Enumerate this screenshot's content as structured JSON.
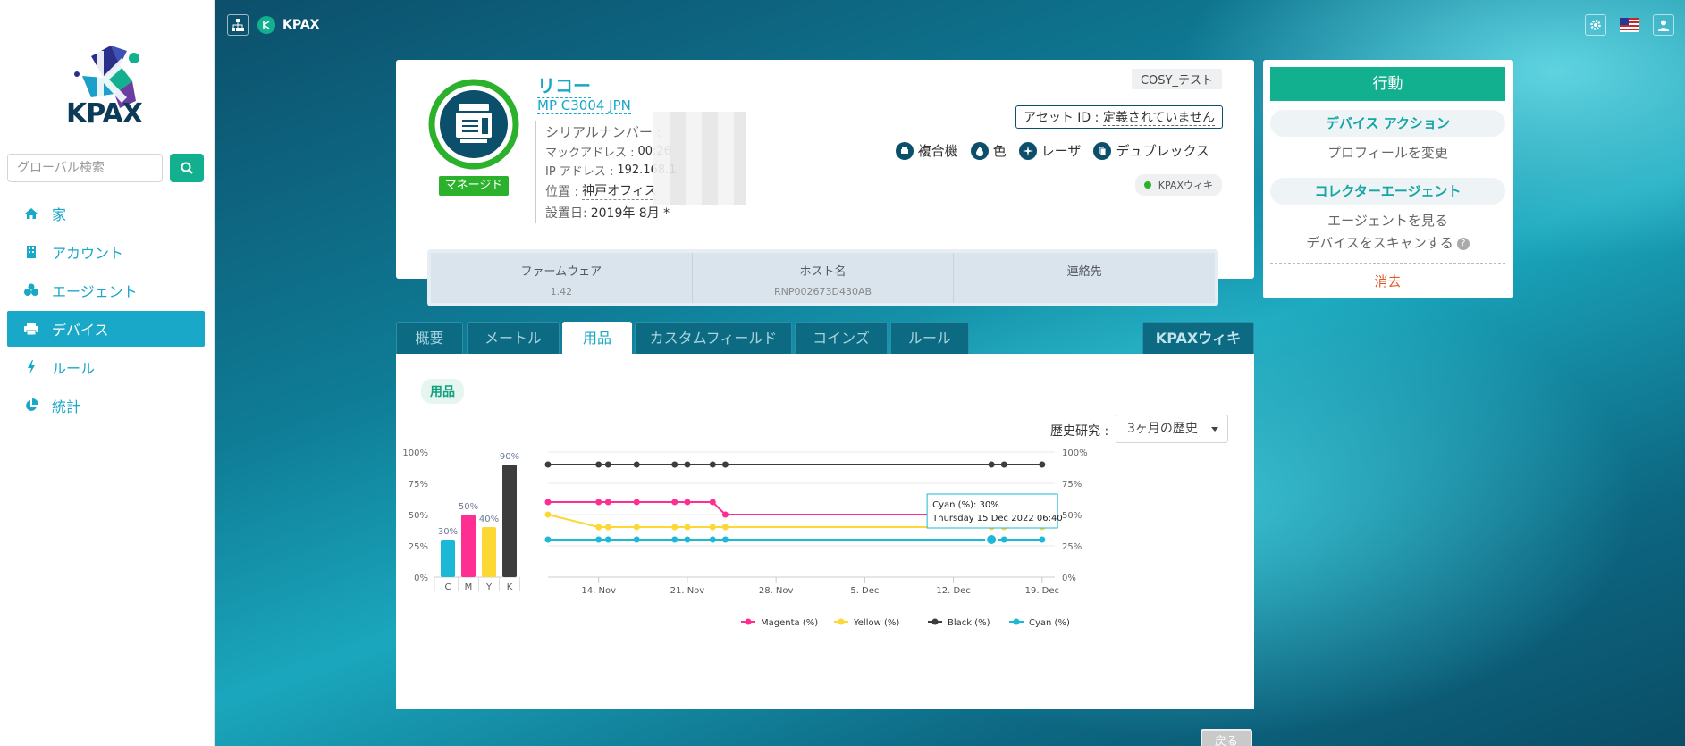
{
  "app": {
    "name": "KPAX",
    "logo_text": "KPAX"
  },
  "sidebar": {
    "search_placeholder": "グローバル検索",
    "items": [
      {
        "label": "家",
        "icon": "home-icon"
      },
      {
        "label": "アカウント",
        "icon": "building-icon"
      },
      {
        "label": "エージェント",
        "icon": "agents-icon"
      },
      {
        "label": "デバイス",
        "icon": "printer-icon",
        "active": true
      },
      {
        "label": "ルール",
        "icon": "bolt-icon"
      },
      {
        "label": "統計",
        "icon": "pie-chart-icon"
      }
    ]
  },
  "device": {
    "brand": "リコー",
    "model": "MP C3004 JPN",
    "managed_label": "マネージド",
    "serial_label": "シリアルナンバー :",
    "mac_label": "マックアドレス :",
    "mac_value": "00:26",
    "ip_label": "IP アドレス :",
    "ip_value": "192.168.1",
    "location_label": "位置 :",
    "location_value": "神戸オフィス",
    "install_label": "設置日:",
    "install_value": "2019年 8月 *",
    "tag": "COSY_テスト",
    "asset_label": "アセット ID : ",
    "asset_value": "定義されていません",
    "capabilities": [
      {
        "label": "複合機",
        "icon": "mfp-icon"
      },
      {
        "label": "色",
        "icon": "drop-icon"
      },
      {
        "label": "レーザ",
        "icon": "laser-icon"
      },
      {
        "label": "デュプレックス",
        "icon": "duplex-icon"
      }
    ],
    "wiki_label": "KPAXウィキ",
    "specs": [
      {
        "label": "ファームウェア",
        "value": "1.42"
      },
      {
        "label": "ホスト名",
        "value": "RNP002673D430AB"
      },
      {
        "label": "連絡先",
        "value": ""
      }
    ]
  },
  "actions": {
    "title": "行動",
    "device_actions_label": "デバイス アクション",
    "change_profile": "プロフィールを変更",
    "collector_agent_label": "コレクターエージェント",
    "view_agent": "エージェントを見る",
    "scan_device": "デバイスをスキャンする",
    "delete": "消去"
  },
  "tabs": [
    {
      "label": "概要"
    },
    {
      "label": "メートル"
    },
    {
      "label": "用品",
      "active": true
    },
    {
      "label": "カスタムフィールド"
    },
    {
      "label": "コインズ"
    },
    {
      "label": "ルール"
    }
  ],
  "wiki_tab": "KPAXウィキ",
  "supplies": {
    "section_label": "用品",
    "history_label": "歴史研究 :",
    "history_selected": "3ヶ月の歴史",
    "back_label": "戻る"
  },
  "chart_data": [
    {
      "type": "bar",
      "categories": [
        "C",
        "M",
        "Y",
        "K"
      ],
      "values": [
        30,
        50,
        40,
        90
      ],
      "data_labels": [
        "30%",
        "50%",
        "40%",
        "90%"
      ],
      "colors": [
        "#1bb9d6",
        "#ff2e92",
        "#fdd835",
        "#3d3d3d"
      ],
      "ylim": [
        0,
        100
      ],
      "yticks": [
        "0%",
        "25%",
        "50%",
        "75%",
        "100%"
      ]
    },
    {
      "type": "line",
      "xlim": [
        "2022-11-10",
        "2022-12-20"
      ],
      "xticks": [
        "14. Nov",
        "21. Nov",
        "28. Nov",
        "5. Dec",
        "12. Dec",
        "19. Dec"
      ],
      "xtick_dates": [
        "2022-11-14",
        "2022-11-21",
        "2022-11-28",
        "2022-12-05",
        "2022-12-12",
        "2022-12-19"
      ],
      "ylim": [
        0,
        100
      ],
      "yticks": [
        "0%",
        "25%",
        "50%",
        "75%",
        "100%"
      ],
      "series": [
        {
          "name": "Magenta (%)",
          "color": "#ff2e92",
          "points": [
            [
              "2022-11-10",
              60
            ],
            [
              "2022-11-14",
              60
            ],
            [
              "2022-11-14 18:00",
              60
            ],
            [
              "2022-11-17",
              60
            ],
            [
              "2022-11-20",
              60
            ],
            [
              "2022-11-21",
              60
            ],
            [
              "2022-11-23",
              60
            ],
            [
              "2022-11-24",
              50
            ],
            [
              "2022-12-15",
              50
            ],
            [
              "2022-12-16",
              50
            ],
            [
              "2022-12-19",
              50
            ]
          ]
        },
        {
          "name": "Yellow (%)",
          "color": "#fdd835",
          "points": [
            [
              "2022-11-10",
              50
            ],
            [
              "2022-11-14",
              40
            ],
            [
              "2022-11-14 18:00",
              40
            ],
            [
              "2022-11-17",
              40
            ],
            [
              "2022-11-20",
              40
            ],
            [
              "2022-11-21",
              40
            ],
            [
              "2022-11-23",
              40
            ],
            [
              "2022-11-24",
              40
            ],
            [
              "2022-12-15",
              40
            ],
            [
              "2022-12-16",
              40
            ],
            [
              "2022-12-19",
              40
            ]
          ]
        },
        {
          "name": "Black (%)",
          "color": "#3d3d3d",
          "points": [
            [
              "2022-11-10",
              90
            ],
            [
              "2022-11-14",
              90
            ],
            [
              "2022-11-14 18:00",
              90
            ],
            [
              "2022-11-17",
              90
            ],
            [
              "2022-11-20",
              90
            ],
            [
              "2022-11-21",
              90
            ],
            [
              "2022-11-23",
              90
            ],
            [
              "2022-11-24",
              90
            ],
            [
              "2022-12-15",
              90
            ],
            [
              "2022-12-16",
              90
            ],
            [
              "2022-12-19",
              90
            ]
          ]
        },
        {
          "name": "Cyan (%)",
          "color": "#1bb9d6",
          "points": [
            [
              "2022-11-10",
              30
            ],
            [
              "2022-11-14",
              30
            ],
            [
              "2022-11-14 18:00",
              30
            ],
            [
              "2022-11-17",
              30
            ],
            [
              "2022-11-20",
              30
            ],
            [
              "2022-11-21",
              30
            ],
            [
              "2022-11-23",
              30
            ],
            [
              "2022-11-24",
              30
            ],
            [
              "2022-12-15",
              30
            ],
            [
              "2022-12-16",
              30
            ],
            [
              "2022-12-19",
              30
            ]
          ]
        }
      ],
      "tooltip": {
        "line1": "Cyan (%): 30%",
        "line2": "Thursday 15 Dec 2022 06:40",
        "series": "Cyan (%)",
        "date": "2022-12-15"
      }
    }
  ]
}
